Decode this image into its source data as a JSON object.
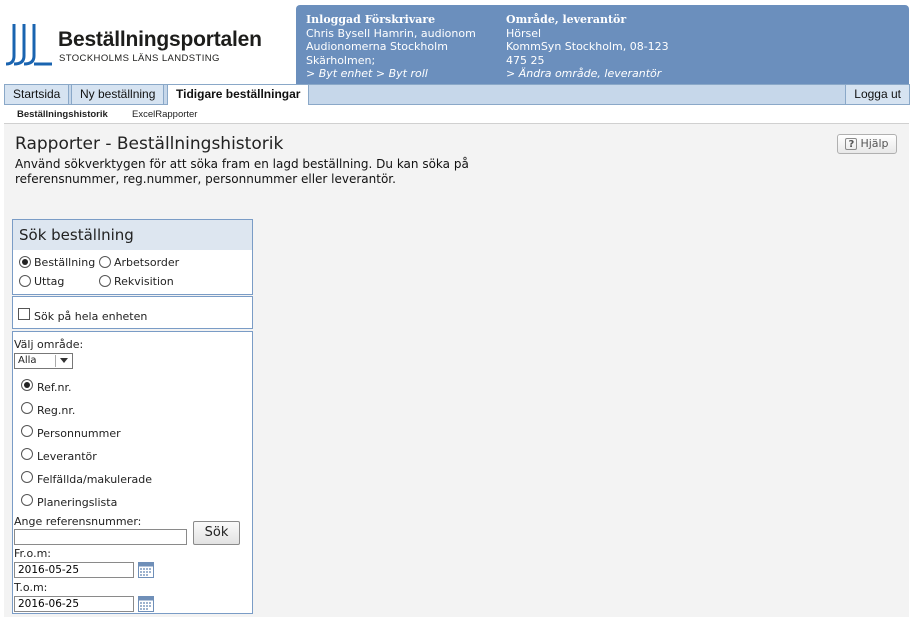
{
  "header": {
    "logo_title": "Beställningsportalen",
    "logo_subtitle": "STOCKHOLMS LÄNS LANDSTING",
    "prescriber": {
      "heading": "Inloggad Förskrivare",
      "name": "Chris Bysell Hamrin, audionom",
      "unit": "Audionomerna Stockholm",
      "location": "Skärholmen;",
      "links": "> Byt enhet > Byt roll"
    },
    "area": {
      "heading": "Område, leverantör",
      "area": "Hörsel",
      "supplier": "KommSyn Stockholm, 08-123",
      "phone": "475 25",
      "link": "> Ändra område, leverantör"
    },
    "colors": {
      "info_bg": "#6b8fbd",
      "nav_bg": "#c6d7ea"
    }
  },
  "nav": {
    "tabs": [
      "Startsida",
      "Ny beställning",
      "Tidigare beställningar"
    ],
    "active": "Tidigare beställningar",
    "logout": "Logga ut"
  },
  "subnav": {
    "items": [
      "Beställningshistorik",
      "ExcelRapporter"
    ]
  },
  "main": {
    "title": "Rapporter - Beställningshistorik",
    "intro": "Använd sökverktygen för att söka fram en lagd beställning. Du kan söka på referensnummer, reg.nummer, personnummer eller leverantör.",
    "help_label": "Hjälp"
  },
  "search": {
    "heading": "Sök beställning",
    "type_options": [
      "Beställning",
      "Arbetsorder",
      "Uttag",
      "Rekvisition"
    ],
    "type_selected": "Beställning",
    "whole_unit_label": "Sök på hela enheten",
    "area_label": "Välj område:",
    "area_value": "Alla",
    "field_options": [
      "Ref.nr.",
      "Reg.nr.",
      "Personnummer",
      "Leverantör",
      "Felfällda/makulerade",
      "Planeringslista"
    ],
    "field_selected": "Ref.nr.",
    "input_label": "Ange referensnummer:",
    "input_value": "",
    "search_button": "Sök",
    "from_label": "Fr.o.m:",
    "from_value": "2016-05-25",
    "to_label": "T.o.m:",
    "to_value": "2016-06-25"
  }
}
